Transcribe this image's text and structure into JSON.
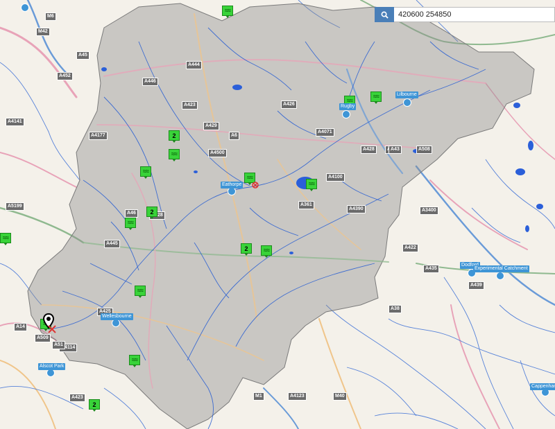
{
  "search": {
    "value": "420600 254850",
    "icon": "search-icon"
  },
  "stations": [
    {
      "label": "Rugby"
    },
    {
      "label": "Lilbourne"
    },
    {
      "label": "Eathorpe"
    },
    {
      "label": "Wellesbourne"
    },
    {
      "label": "Alscot Park"
    },
    {
      "label": "Dodford"
    },
    {
      "label": "Experimental Catchment"
    },
    {
      "label": "Cappenham"
    }
  ],
  "gauges": [
    {
      "count": "2"
    },
    {
      "count": "2"
    },
    {
      "count": "2"
    },
    {
      "count": "2"
    }
  ],
  "roads": [
    "M6",
    "M42",
    "A45",
    "A452",
    "A4141",
    "A444",
    "A446",
    "A423",
    "A426",
    "A4071",
    "A428",
    "A5",
    "A508",
    "A4177",
    "A429",
    "A46",
    "A445",
    "A425",
    "A4100",
    "A361",
    "A43",
    "A3400",
    "A422",
    "A435",
    "A439",
    "A4390",
    "A38",
    "M1",
    "M40",
    "A4123",
    "A4114",
    "A423",
    "A14",
    "A509",
    "A51",
    "A5199",
    "A428",
    "A4500",
    "A6"
  ],
  "colors": {
    "catchment": "#9a9a9a",
    "gauge": "#39d339",
    "station": "#3e95d6",
    "water": "#2b5fd9",
    "accent": "#4a7fb8"
  }
}
